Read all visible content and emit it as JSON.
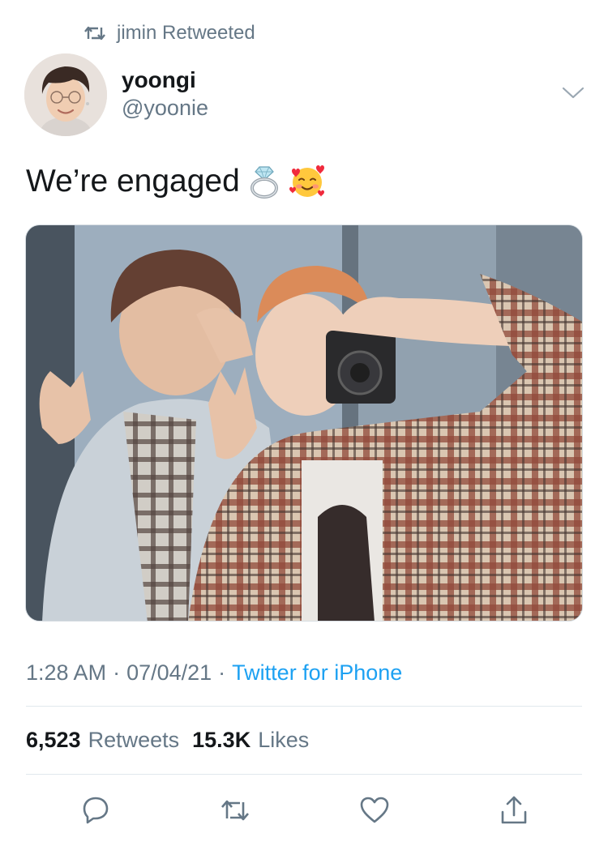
{
  "retweet_context": {
    "icon": "retweet-icon",
    "text": "jimin Retweeted"
  },
  "author": {
    "display_name": "yoongi",
    "handle": "@yoonie"
  },
  "tweet": {
    "text": "We’re engaged",
    "emojis": [
      "ring-emoji",
      "smiling-face-with-hearts-emoji"
    ]
  },
  "meta": {
    "time": "1:28 AM",
    "separator": "·",
    "date": "07/04/21",
    "source": "Twitter for iPhone"
  },
  "stats": {
    "retweets_count": "6,523",
    "retweets_label": "Retweets",
    "likes_count": "15.3K",
    "likes_label": "Likes"
  },
  "actions": [
    "reply-icon",
    "retweet-icon",
    "like-icon",
    "share-icon"
  ],
  "colors": {
    "accent": "#1da1f2",
    "secondary_text": "#657786",
    "divider": "#e1e8ed"
  }
}
